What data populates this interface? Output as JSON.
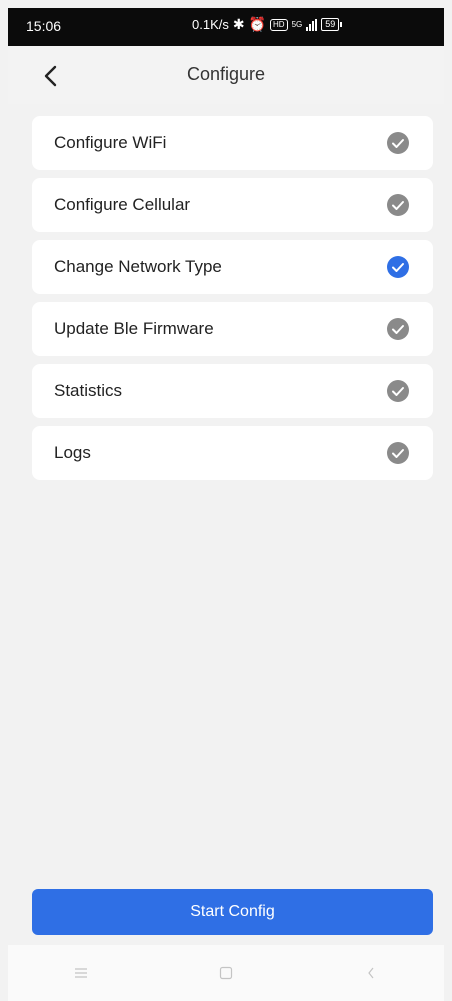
{
  "status_bar": {
    "time": "15:06",
    "net_speed": "0.1K/s",
    "network": "5G",
    "hd": "HD",
    "battery": "59",
    "icons": [
      "bluetooth-icon",
      "alarm-icon",
      "hd-icon",
      "signal-icon",
      "battery-icon"
    ]
  },
  "header": {
    "title": "Configure",
    "back_icon": "chevron-left-icon"
  },
  "menu": {
    "items": [
      {
        "label": "Configure WiFi",
        "selected": false
      },
      {
        "label": "Configure Cellular",
        "selected": false
      },
      {
        "label": "Change Network Type",
        "selected": true
      },
      {
        "label": "Update Ble Firmware",
        "selected": false
      },
      {
        "label": "Statistics",
        "selected": false
      },
      {
        "label": "Logs",
        "selected": false
      }
    ]
  },
  "footer": {
    "start_button": "Start Config"
  },
  "nav_bar": {
    "icons": [
      "menu-icon",
      "home-square-icon",
      "back-icon"
    ]
  },
  "colors": {
    "accent": "#2f6fe5",
    "unselected_check": "#8a8a8a",
    "selected_check": "#2f6fe5"
  }
}
